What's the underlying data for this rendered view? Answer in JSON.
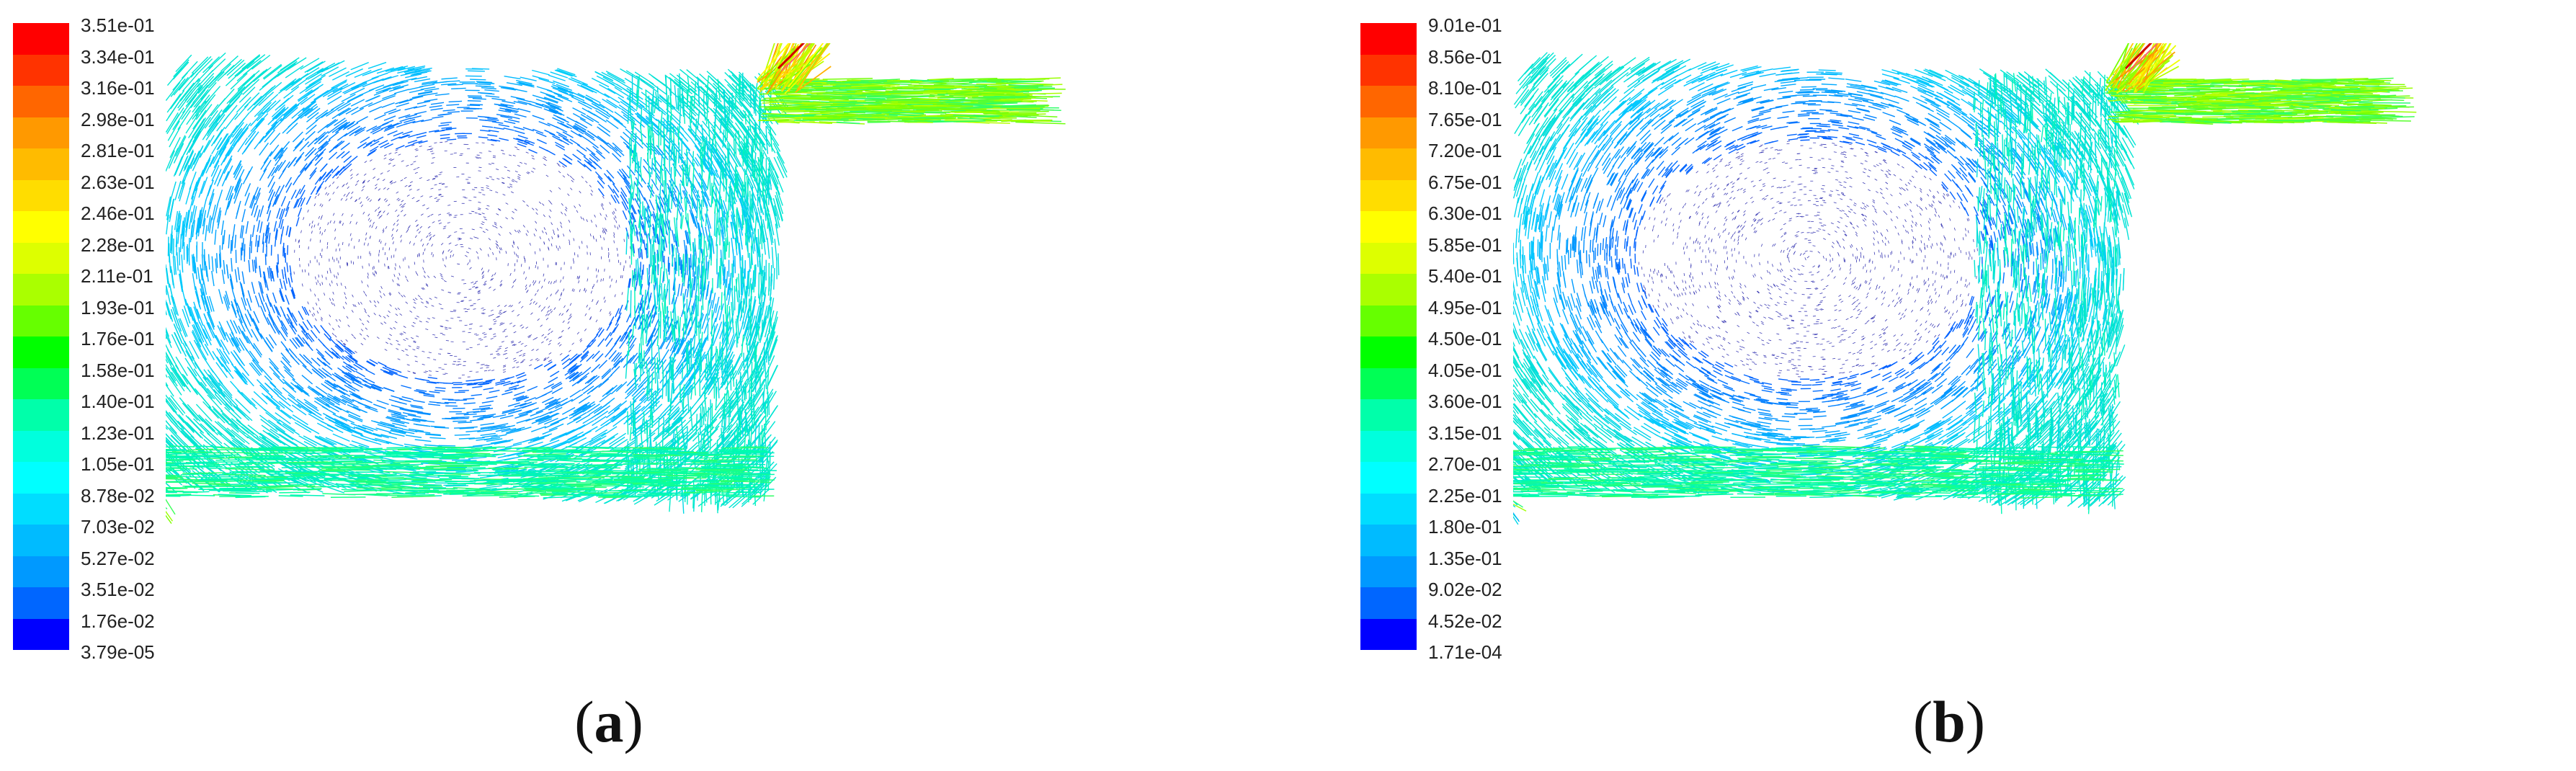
{
  "panels": [
    {
      "caption_letter": "a",
      "colorbar_labels": [
        "3.51e-01",
        "3.34e-01",
        "3.16e-01",
        "2.98e-01",
        "2.81e-01",
        "2.63e-01",
        "2.46e-01",
        "2.28e-01",
        "2.11e-01",
        "1.93e-01",
        "1.76e-01",
        "1.58e-01",
        "1.40e-01",
        "1.23e-01",
        "1.05e-01",
        "8.78e-02",
        "7.03e-02",
        "5.27e-02",
        "3.51e-02",
        "1.76e-02",
        "3.79e-05"
      ]
    },
    {
      "caption_letter": "b",
      "colorbar_labels": [
        "9.01e-01",
        "8.56e-01",
        "8.10e-01",
        "7.65e-01",
        "7.20e-01",
        "6.75e-01",
        "6.30e-01",
        "5.85e-01",
        "5.40e-01",
        "4.95e-01",
        "4.50e-01",
        "4.05e-01",
        "3.60e-01",
        "3.15e-01",
        "2.70e-01",
        "2.25e-01",
        "1.80e-01",
        "1.35e-01",
        "9.02e-02",
        "4.52e-02",
        "1.71e-04"
      ]
    }
  ],
  "colormap": [
    "#ff0000",
    "#ff3300",
    "#ff6600",
    "#ff9900",
    "#ffbb00",
    "#ffdd00",
    "#ffff00",
    "#ddff00",
    "#aaff00",
    "#66ff00",
    "#00ff00",
    "#00ff55",
    "#00ffaa",
    "#00ffdd",
    "#00ffff",
    "#00ddff",
    "#00bbff",
    "#0099ff",
    "#0066ff",
    "#0000ff"
  ]
}
